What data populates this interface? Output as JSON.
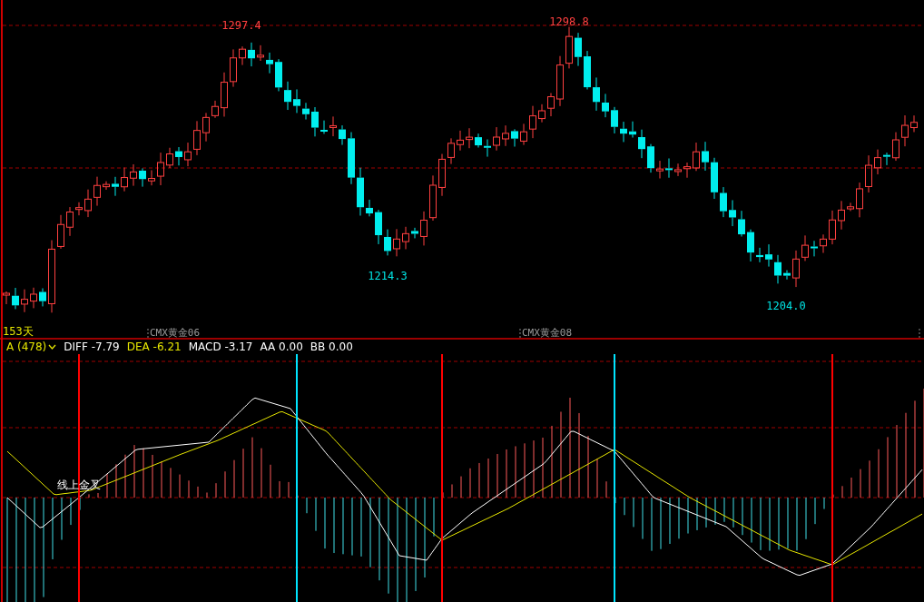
{
  "price_chart": {
    "extremes": [
      {
        "kind": "high",
        "text": "1297.4"
      },
      {
        "kind": "low",
        "text": "1214.3"
      },
      {
        "kind": "high",
        "text": "1298.8"
      },
      {
        "kind": "low",
        "text": "1204.0"
      }
    ],
    "period_label": "153天",
    "contract_labels": [
      "CMX黄金06",
      "CMX黄金08"
    ]
  },
  "indicator": {
    "selector": "A (478)",
    "values": [
      {
        "text": "DIFF -7.79",
        "color": "#ffffff"
      },
      {
        "text": "DEA -6.21",
        "color": "#e6e600"
      },
      {
        "text": "MACD -3.17",
        "color": "#ffffff"
      },
      {
        "text": "AA 0.00",
        "color": "#ffffff"
      },
      {
        "text": "BB 0.00",
        "color": "#ffffff"
      }
    ],
    "annotation": "线上金叉",
    "signals": [
      {
        "color": "#ff0000"
      },
      {
        "color": "#00e5ff"
      },
      {
        "color": "#ff0000"
      },
      {
        "color": "#00e5ff"
      },
      {
        "color": "#ff0000"
      }
    ]
  }
}
